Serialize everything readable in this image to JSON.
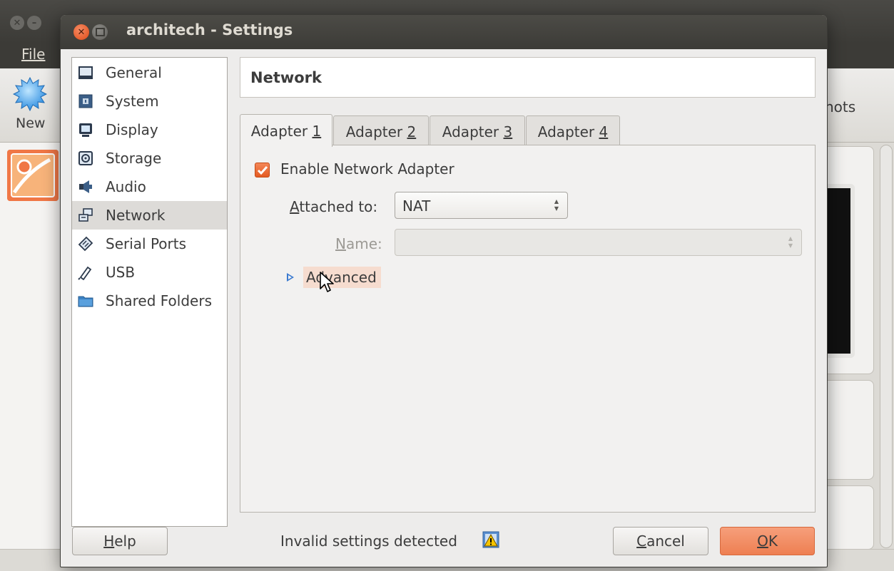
{
  "background_window": {
    "menu": {
      "file": "File"
    },
    "toolbar": {
      "new_label": "New",
      "snapshots_label": "hots"
    }
  },
  "dialog": {
    "title": "architech - Settings",
    "categories": [
      {
        "label": "General",
        "icon": "general-icon"
      },
      {
        "label": "System",
        "icon": "system-icon"
      },
      {
        "label": "Display",
        "icon": "display-icon"
      },
      {
        "label": "Storage",
        "icon": "storage-icon"
      },
      {
        "label": "Audio",
        "icon": "audio-icon"
      },
      {
        "label": "Network",
        "icon": "network-icon",
        "selected": true
      },
      {
        "label": "Serial Ports",
        "icon": "serial-ports-icon"
      },
      {
        "label": "USB",
        "icon": "usb-icon"
      },
      {
        "label": "Shared Folders",
        "icon": "shared-folders-icon"
      }
    ],
    "page_title": "Network",
    "tabs": [
      {
        "label": "Adapter ",
        "mnemonic": "1",
        "active": true
      },
      {
        "label": "Adapter ",
        "mnemonic": "2"
      },
      {
        "label": "Adapter ",
        "mnemonic": "3"
      },
      {
        "label": "Adapter ",
        "mnemonic": "4"
      }
    ],
    "adapter": {
      "enable_label": "Enable Network Adapter",
      "enable_checked": true,
      "attached_to_label_mnemonic": "A",
      "attached_to_label_rest": "ttached to:",
      "attached_to_value": "NAT",
      "name_label_mnemonic": "N",
      "name_label_rest": "ame:",
      "name_value": "",
      "advanced_label": "Advanced"
    },
    "footer": {
      "help_mnemonic": "H",
      "help_rest": "elp",
      "status_text": "Invalid settings detected",
      "cancel_mnemonic": "C",
      "cancel_rest": "ancel",
      "ok_mnemonic": "O",
      "ok_rest": "K"
    },
    "colors": {
      "accent": "#ee7f52",
      "selection": "#dddbd8",
      "titlebar": "#3c3b37"
    }
  }
}
